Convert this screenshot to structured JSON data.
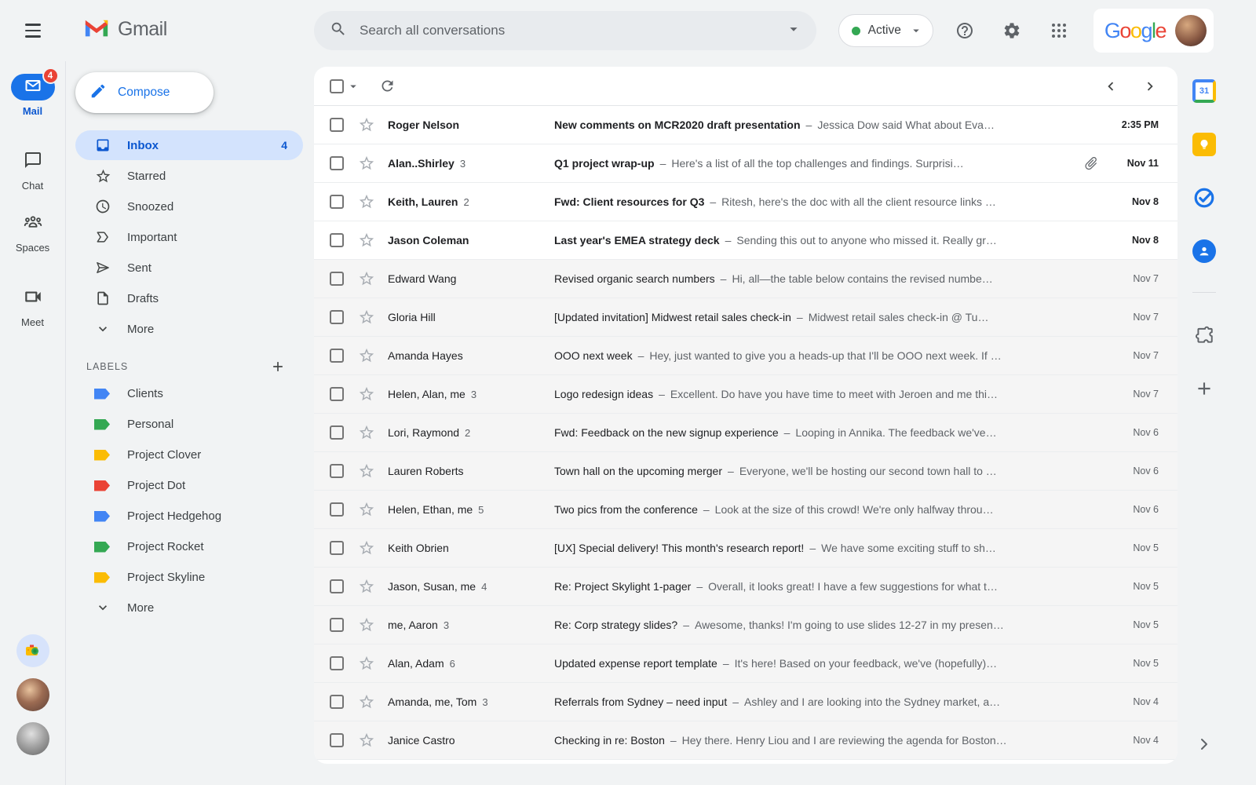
{
  "header": {
    "brand": "Gmail",
    "search_placeholder": "Search all conversations",
    "status_label": "Active",
    "google_logo_letters": [
      {
        "ch": "G",
        "color": "#4285F4"
      },
      {
        "ch": "o",
        "color": "#EA4335"
      },
      {
        "ch": "o",
        "color": "#FBBC05"
      },
      {
        "ch": "g",
        "color": "#4285F4"
      },
      {
        "ch": "l",
        "color": "#34A853"
      },
      {
        "ch": "e",
        "color": "#EA4335"
      }
    ]
  },
  "left_rail": {
    "apps": [
      {
        "label": "Mail",
        "icon": "mail",
        "badge": "4",
        "active": true
      },
      {
        "label": "Chat",
        "icon": "chat",
        "badge": "",
        "active": false
      },
      {
        "label": "Spaces",
        "icon": "spaces",
        "badge": "",
        "active": false
      },
      {
        "label": "Meet",
        "icon": "meet",
        "badge": "",
        "active": false
      }
    ]
  },
  "sidebar": {
    "compose_label": "Compose",
    "items": [
      {
        "label": "Inbox",
        "icon": "inbox",
        "count": "4",
        "active": true
      },
      {
        "label": "Starred",
        "icon": "star",
        "count": "",
        "active": false
      },
      {
        "label": "Snoozed",
        "icon": "clock",
        "count": "",
        "active": false
      },
      {
        "label": "Important",
        "icon": "important",
        "count": "",
        "active": false
      },
      {
        "label": "Sent",
        "icon": "send",
        "count": "",
        "active": false
      },
      {
        "label": "Drafts",
        "icon": "draft",
        "count": "",
        "active": false
      },
      {
        "label": "More",
        "icon": "chevron-down",
        "count": "",
        "active": false
      }
    ],
    "labels_header": "LABELS",
    "labels": [
      {
        "name": "Clients",
        "color": "#4285F4"
      },
      {
        "name": "Personal",
        "color": "#34A853"
      },
      {
        "name": "Project Clover",
        "color": "#FBBC04"
      },
      {
        "name": "Project Dot",
        "color": "#EA4335"
      },
      {
        "name": "Project Hedgehog",
        "color": "#4285F4"
      },
      {
        "name": "Project Rocket",
        "color": "#34A853"
      },
      {
        "name": "Project Skyline",
        "color": "#FBBC04"
      }
    ],
    "more_label": "More"
  },
  "list": {
    "separator": "–",
    "messages": [
      {
        "sender": "Roger Nelson",
        "count": "",
        "subject": "New comments on MCR2020 draft presentation",
        "snippet": "Jessica Dow said What about Eva…",
        "date": "2:35 PM",
        "unread": true,
        "attachment": false
      },
      {
        "sender": "Alan..Shirley",
        "count": "3",
        "subject": "Q1 project wrap-up",
        "snippet": "Here's a list of all the top challenges and findings. Surprisi…",
        "date": "Nov 11",
        "unread": true,
        "attachment": true
      },
      {
        "sender": "Keith, Lauren",
        "count": "2",
        "subject": "Fwd: Client resources for Q3",
        "snippet": "Ritesh, here's the doc with all the client resource links …",
        "date": "Nov 8",
        "unread": true,
        "attachment": false
      },
      {
        "sender": "Jason Coleman",
        "count": "",
        "subject": "Last year's EMEA strategy deck",
        "snippet": "Sending this out to anyone who missed it. Really gr…",
        "date": "Nov 8",
        "unread": true,
        "attachment": false
      },
      {
        "sender": "Edward Wang",
        "count": "",
        "subject": "Revised organic search numbers",
        "snippet": "Hi, all—the table below contains the revised numbe…",
        "date": "Nov 7",
        "unread": false,
        "attachment": false
      },
      {
        "sender": "Gloria Hill",
        "count": "",
        "subject": "[Updated invitation] Midwest retail sales check-in",
        "snippet": "Midwest retail sales check-in @ Tu…",
        "date": "Nov 7",
        "unread": false,
        "attachment": false
      },
      {
        "sender": "Amanda Hayes",
        "count": "",
        "subject": "OOO next week",
        "snippet": "Hey, just wanted to give you a heads-up that I'll be OOO next week. If …",
        "date": "Nov 7",
        "unread": false,
        "attachment": false
      },
      {
        "sender": "Helen, Alan, me",
        "count": "3",
        "subject": "Logo redesign ideas",
        "snippet": "Excellent. Do have you have time to meet with Jeroen and me thi…",
        "date": "Nov 7",
        "unread": false,
        "attachment": false
      },
      {
        "sender": "Lori, Raymond",
        "count": "2",
        "subject": "Fwd: Feedback on the new signup experience",
        "snippet": "Looping in Annika. The feedback we've…",
        "date": "Nov 6",
        "unread": false,
        "attachment": false
      },
      {
        "sender": "Lauren Roberts",
        "count": "",
        "subject": "Town hall on the upcoming merger",
        "snippet": "Everyone, we'll be hosting our second town hall to …",
        "date": "Nov 6",
        "unread": false,
        "attachment": false
      },
      {
        "sender": "Helen, Ethan, me",
        "count": "5",
        "subject": "Two pics from the conference",
        "snippet": "Look at the size of this crowd! We're only halfway throu…",
        "date": "Nov 6",
        "unread": false,
        "attachment": false
      },
      {
        "sender": "Keith Obrien",
        "count": "",
        "subject": "[UX] Special delivery! This month's research report!",
        "snippet": "We have some exciting stuff to sh…",
        "date": "Nov 5",
        "unread": false,
        "attachment": false
      },
      {
        "sender": "Jason, Susan, me",
        "count": "4",
        "subject": "Re: Project Skylight 1-pager",
        "snippet": "Overall, it looks great! I have a few suggestions for what t…",
        "date": "Nov 5",
        "unread": false,
        "attachment": false
      },
      {
        "sender": "me, Aaron",
        "count": "3",
        "subject": "Re: Corp strategy slides?",
        "snippet": "Awesome, thanks! I'm going to use slides 12-27 in my presen…",
        "date": "Nov 5",
        "unread": false,
        "attachment": false
      },
      {
        "sender": "Alan, Adam",
        "count": "6",
        "subject": "Updated expense report template",
        "snippet": "It's here! Based on your feedback, we've (hopefully)…",
        "date": "Nov 5",
        "unread": false,
        "attachment": false
      },
      {
        "sender": "Amanda, me, Tom",
        "count": "3",
        "subject": "Referrals from Sydney – need input",
        "snippet": "Ashley and I are looking into the Sydney market, a…",
        "date": "Nov 4",
        "unread": false,
        "attachment": false
      },
      {
        "sender": "Janice Castro",
        "count": "",
        "subject": "Checking in re: Boston",
        "snippet": "Hey there. Henry Liou and I are reviewing the agenda for Boston…",
        "date": "Nov 4",
        "unread": false,
        "attachment": false
      }
    ]
  },
  "right_rail": {
    "calendar_label": "31"
  },
  "palette": {
    "accent_blue": "#1a73e8",
    "inbox_pill_blue": "#d3e3fd",
    "active_text_blue": "#0b57d0",
    "badge_red": "#ea4335",
    "status_green": "#34a853",
    "background_gray": "#f1f3f4",
    "read_row_gray": "#f5f5f5"
  }
}
